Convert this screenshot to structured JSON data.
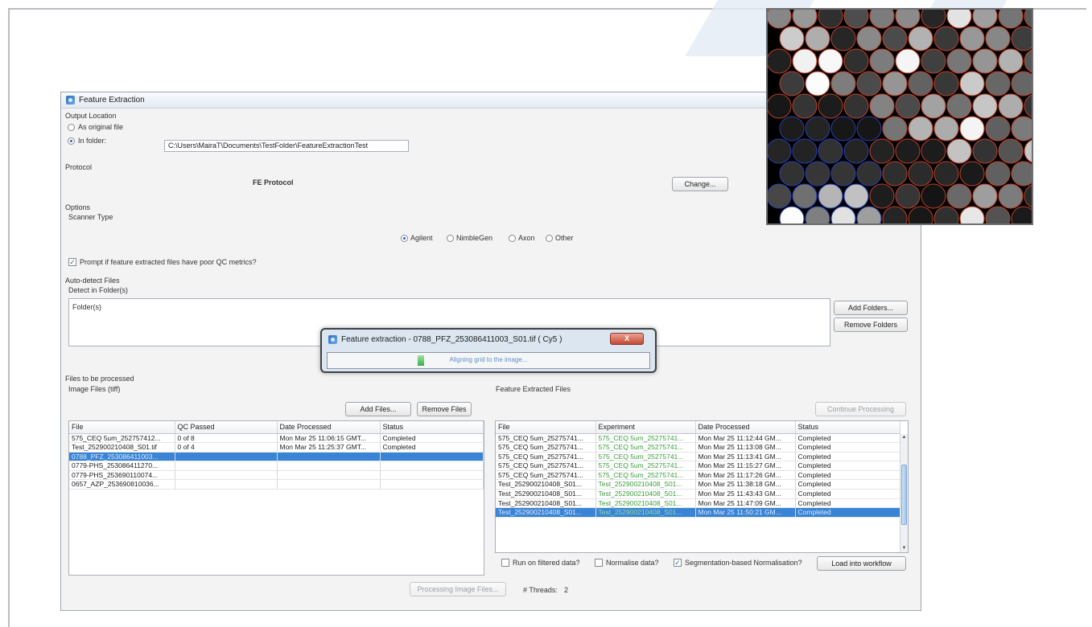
{
  "window": {
    "title": "Feature Extraction"
  },
  "output_location": {
    "section_label": "Output Location",
    "as_original_label": "As original file",
    "in_folder_label": "In folder:",
    "folder_path": "C:\\Users\\MairaT\\Documents\\TestFolder\\FeatureExtractionTest",
    "selected": "in_folder"
  },
  "protocol": {
    "section_label": "Protocol",
    "name": "FE Protocol",
    "change_button": "Change..."
  },
  "options": {
    "section_label": "Options",
    "scanner_type_label": "Scanner Type",
    "scanners": [
      "Agilent",
      "NimbleGen",
      "Axon",
      "Other"
    ],
    "selected_scanner": "Agilent",
    "prompt_qc_label": "Prompt if feature extracted files have poor QC metrics?",
    "prompt_qc_checked": true
  },
  "auto_detect": {
    "section_label": "Auto-detect Files",
    "detect_label": "Detect in Folder(s)",
    "folders_header": "Folder(s)",
    "add_folders_button": "Add Folders...",
    "remove_folders_button": "Remove Folders"
  },
  "progress_dialog": {
    "title": "Feature extraction - 0788_PFZ_253086411003_S01.tif ( Cy5 )",
    "close_label": "X",
    "status_text": "Aligning grid to the image...",
    "progress": 0.02
  },
  "files_to_process": {
    "section_label": "Files to be processed",
    "image_files_label": "Image Files (tiff)",
    "add_files_button": "Add Files...",
    "remove_files_button": "Remove Files",
    "columns": [
      "File",
      "QC Passed",
      "Date Processed",
      "Status"
    ],
    "rows": [
      [
        "575_CEQ 5um_252757412...",
        "0 of 8",
        "Mon Mar 25 11:06:15 GMT...",
        "Completed"
      ],
      [
        "Test_252900210408_S01.tif",
        "0 of 4",
        "Mon Mar 25 11:25:37 GMT...",
        "Completed"
      ],
      [
        "0788_PFZ_253086411003...",
        "",
        "",
        ""
      ],
      [
        "0779-PHS_253086411270...",
        "",
        "",
        ""
      ],
      [
        "0779-PHS_253690110074...",
        "",
        "",
        ""
      ],
      [
        "0657_AZP_253690810036...",
        "",
        "",
        ""
      ]
    ],
    "selected_row": 2
  },
  "extracted": {
    "label": "Feature Extracted Files",
    "continue_button": "Continue Processing",
    "columns": [
      "File",
      "Experiment",
      "Date Processed",
      "Status"
    ],
    "rows": [
      [
        "575_CEQ 5um_25275741...",
        "575_CEQ 5um_25275741...",
        "Mon Mar 25 11:12:44 GM...",
        "Completed"
      ],
      [
        "575_CEQ 5um_25275741...",
        "575_CEQ 5um_25275741...",
        "Mon Mar 25 11:13:08 GM...",
        "Completed"
      ],
      [
        "575_CEQ 5um_25275741...",
        "575_CEQ 5um_25275741...",
        "Mon Mar 25 11:13:41 GM...",
        "Completed"
      ],
      [
        "575_CEQ 5um_25275741...",
        "575_CEQ 5um_25275741...",
        "Mon Mar 25 11:15:27 GM...",
        "Completed"
      ],
      [
        "575_CEQ 5um_25275741...",
        "575_CEQ 5um_25275741...",
        "Mon Mar 25 11:17:26 GM...",
        "Completed"
      ],
      [
        "Test_252900210408_S01...",
        "Test_252900210408_S01...",
        "Mon Mar 25 11:38:18 GM...",
        "Completed"
      ],
      [
        "Test_252900210408_S01...",
        "Test_252900210408_S01...",
        "Mon Mar 25 11:43:43 GM...",
        "Completed"
      ],
      [
        "Test_252900210408_S01...",
        "Test_252900210408_S01...",
        "Mon Mar 25 11:47:09 GM...",
        "Completed"
      ],
      [
        "Test_252900210408_S01...",
        "Test_252900210408_S01...",
        "Mon Mar 25 11:50:21 GM...",
        "Completed"
      ]
    ],
    "selected_row": 8,
    "run_filtered_label": "Run on filtered data?",
    "normalise_label": "Normalise data?",
    "segmentation_label": "Segmentation-based Normalisation?",
    "run_filtered_checked": false,
    "normalise_checked": false,
    "segmentation_checked": true,
    "load_button": "Load into workflow"
  },
  "footer": {
    "processing_button": "Processing Image Files...",
    "threads_label": "# Threads:",
    "threads_value": "2"
  },
  "colors": {
    "selection": "#3a84d6",
    "experiment_text": "#3c9d3c",
    "close_button": "#c24a33"
  },
  "inset_image": {
    "description_icon": "microarray-spot-grid"
  }
}
